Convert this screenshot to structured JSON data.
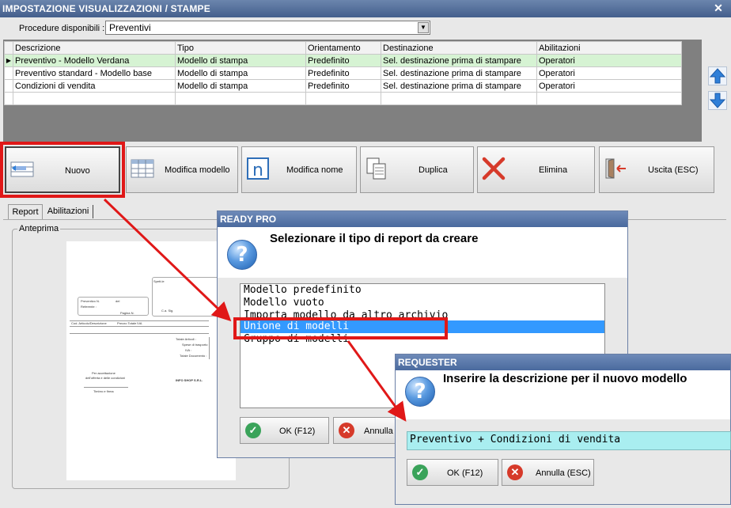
{
  "window": {
    "title": "IMPOSTAZIONE VISUALIZZAZIONI / STAMPE",
    "close_glyph": "✕"
  },
  "procedure": {
    "label": "Procedure disponibili :",
    "value": "Preventivi"
  },
  "grid": {
    "columns": [
      "Descrizione",
      "Tipo",
      "Orientamento",
      "Destinazione",
      "Abilitazioni"
    ],
    "rows": [
      {
        "indicator": "▶",
        "cells": [
          "Preventivo - Modello Verdana",
          "Modello di stampa",
          "Predefinito",
          "Sel. destinazione prima di stampare",
          "Operatori"
        ]
      },
      {
        "indicator": "",
        "cells": [
          "Preventivo standard - Modello base",
          "Modello di stampa",
          "Predefinito",
          "Sel. destinazione prima di stampare",
          "Operatori"
        ]
      },
      {
        "indicator": "",
        "cells": [
          "Condizioni di vendita",
          "Modello di stampa",
          "Predefinito",
          "Sel. destinazione prima di stampare",
          "Operatori"
        ]
      }
    ]
  },
  "toolbar": {
    "nuovo": "Nuovo",
    "modifica_modello": "Modifica modello",
    "modifica_nome": "Modifica nome",
    "duplica": "Duplica",
    "elimina": "Elimina",
    "uscita": "Uscita (ESC)"
  },
  "tabs": {
    "report": "Report",
    "abilitazioni": "Abilitazioni"
  },
  "preview": {
    "group_label": "Anteprima",
    "lines": [
      "Spett.le",
      "Preventivo N.",
      "del",
      "Referente :",
      "Pagina N.",
      "C.a. Sig.",
      "Cod. Articolo/Descrizione",
      "Prezzo Totale IVA",
      "Totale Articoli :",
      "Spese di trasporto :",
      "IVA :",
      "Totale Documento :",
      "Per accettazione",
      "dell'offerta e delle condizioni",
      "INFO SHOP S.R.L.",
      "Timbro e firma"
    ]
  },
  "dialog_ready": {
    "title": "READY PRO",
    "question_glyph": "?",
    "heading": "Selezionare il tipo di report da creare",
    "options": [
      "Modello predefinito",
      "Modello vuoto",
      "Importa modello da altro archivio",
      "Unione di modelli",
      "Gruppo di modelli"
    ],
    "selected_index": 3,
    "ok": "OK (F12)",
    "cancel": "Annulla (ESC)"
  },
  "dialog_requester": {
    "title": "REQUESTER",
    "question_glyph": "?",
    "heading": "Inserire la descrizione per il nuovo modello",
    "input_value": "Preventivo + Condizioni di vendita",
    "ok": "OK (F12)",
    "cancel": "Annulla (ESC)"
  },
  "colors": {
    "highlight_red": "#e01818",
    "selected_row": "#d6f3d3",
    "list_selection": "#3399ff",
    "input_bg": "#a9eef0"
  },
  "icons": {
    "ok": "check-circle-icon",
    "cancel": "x-circle-icon",
    "nav_up": "arrow-up-icon",
    "nav_down": "arrow-down-icon"
  }
}
